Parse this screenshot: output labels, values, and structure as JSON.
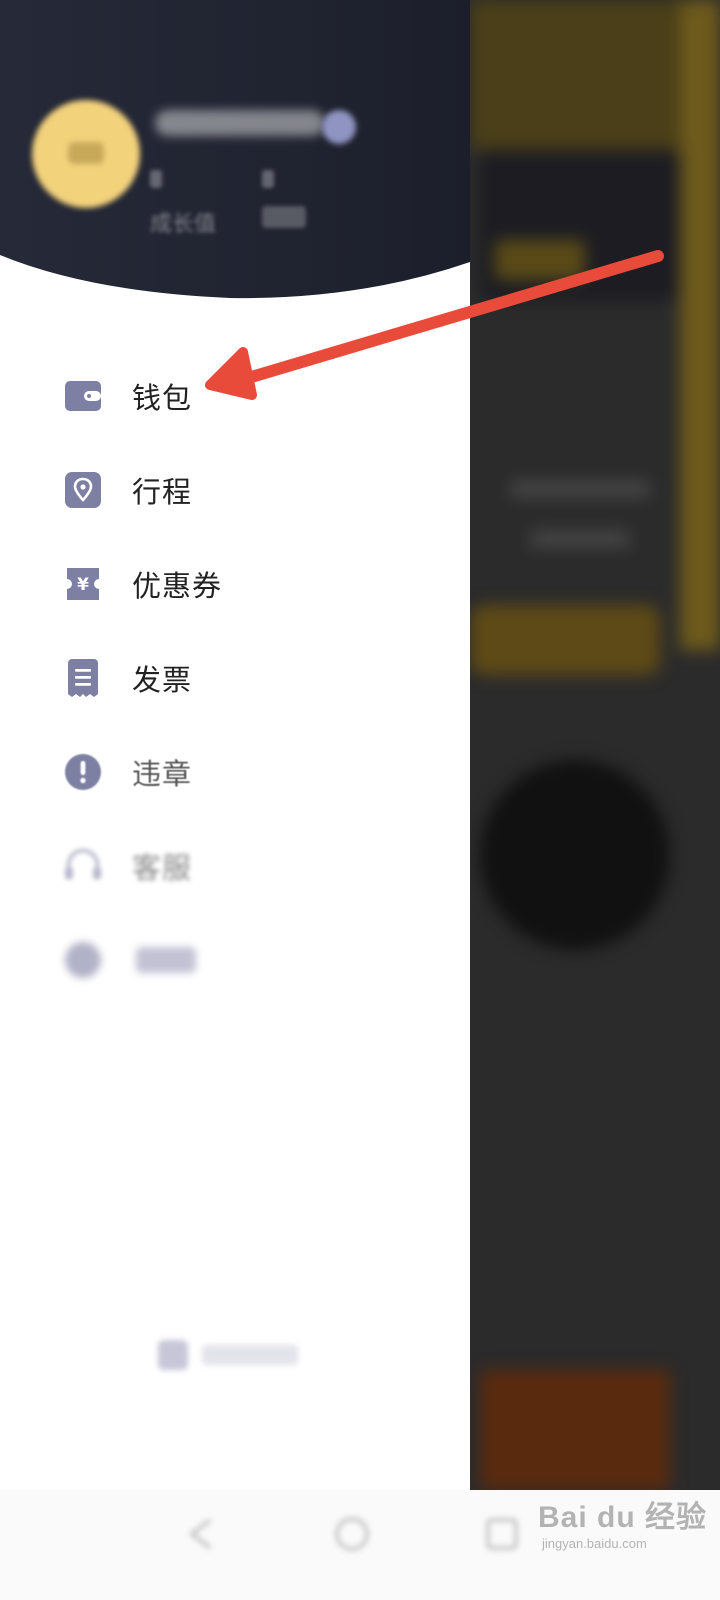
{
  "header": {
    "stats": [
      {
        "label": "成长值"
      }
    ]
  },
  "menu": {
    "items": [
      {
        "id": "wallet",
        "label": "钱包",
        "icon": "wallet-icon"
      },
      {
        "id": "trips",
        "label": "行程",
        "icon": "location-pin-icon"
      },
      {
        "id": "coupons",
        "label": "优惠券",
        "icon": "coupon-ticket-icon"
      },
      {
        "id": "invoice",
        "label": "发票",
        "icon": "receipt-icon"
      },
      {
        "id": "violation",
        "label": "违章",
        "icon": "exclamation-circle-icon"
      },
      {
        "id": "service",
        "label": "客服",
        "icon": "headset-icon"
      }
    ]
  },
  "annotation": {
    "arrow_color": "#e84b3a",
    "target": "wallet"
  },
  "colors": {
    "header_bg": "#1f2230",
    "icon_color": "#7d7fa3",
    "accent_yellow": "#f3d27c"
  },
  "watermark": {
    "main": "Bai du 经验",
    "sub": "jingyan.baidu.com"
  }
}
